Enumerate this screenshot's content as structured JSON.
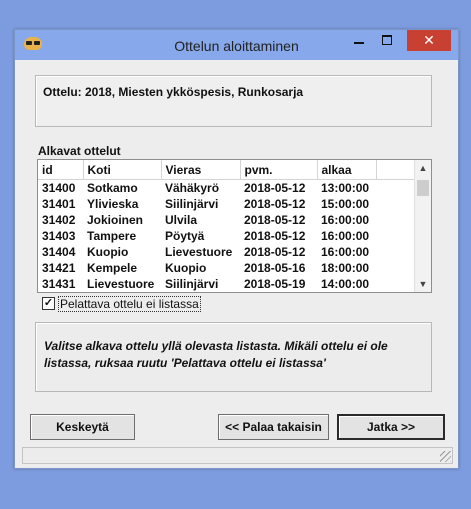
{
  "window": {
    "title": "Ottelun aloittaminen",
    "close_glyph": "✕"
  },
  "info": {
    "text": "Ottelu: 2018, Miesten ykköspesis, Runkosarja"
  },
  "list": {
    "label": "Alkavat ottelut",
    "columns": [
      "id",
      "Koti",
      "Vieras",
      "pvm.",
      "alkaa"
    ],
    "rows": [
      [
        "31400",
        "Sotkamo",
        "Vähäkyrö",
        "2018-05-12",
        "13:00:00"
      ],
      [
        "31401",
        "Ylivieska",
        "Siilinjärvi",
        "2018-05-12",
        "15:00:00"
      ],
      [
        "31402",
        "Jokioinen",
        "Ulvila",
        "2018-05-12",
        "16:00:00"
      ],
      [
        "31403",
        "Tampere",
        "Pöytyä",
        "2018-05-12",
        "16:00:00"
      ],
      [
        "31404",
        "Kuopio",
        "Lievestuore",
        "2018-05-12",
        "16:00:00"
      ],
      [
        "31421",
        "Kempele",
        "Kuopio",
        "2018-05-16",
        "18:00:00"
      ],
      [
        "31431",
        "Lievestuore",
        "Siilinjärvi",
        "2018-05-19",
        "14:00:00"
      ]
    ],
    "scroll_up": "▲",
    "scroll_down": "▼"
  },
  "checkbox": {
    "label": "Pelattava ottelu ei listassa",
    "checked": true,
    "check_glyph": "✓"
  },
  "help": {
    "text": "Valitse alkava ottelu yllä olevasta listasta. Mikäli ottelu ei ole listassa, ruksaa ruutu 'Pelattava ottelu ei listassa'"
  },
  "buttons": {
    "cancel": "Keskeytä",
    "back": "<< Palaa takaisin",
    "next": "Jatka >>"
  },
  "colors": {
    "desktop": "#7d9cdf",
    "titlebar": "#87a8ea",
    "close": "#c84031"
  }
}
